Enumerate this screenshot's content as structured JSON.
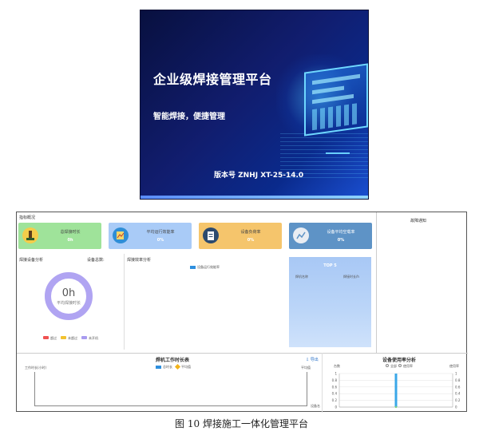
{
  "splash": {
    "title": "企业级焊接管理平台",
    "subtitle": "智能焊接，便捷管理",
    "version": "版本号 ZNHJ XT-25-14.0"
  },
  "overview": {
    "title": "指标概况",
    "kpis": [
      {
        "label": "总焊接时长",
        "value": "0h",
        "icon": "welder-icon",
        "color": "#9fe39a"
      },
      {
        "label": "平均运行效能率",
        "value": "0%",
        "icon": "chart-icon",
        "color": "#a9cbf7"
      },
      {
        "label": "设备负荷率",
        "value": "0%",
        "icon": "clipboard-icon",
        "color": "#f5c56c"
      },
      {
        "label": "设备平均空载率",
        "value": "0%",
        "icon": "gauge-icon",
        "color": "#5e93c6"
      }
    ]
  },
  "notice": {
    "title": "故障通知"
  },
  "device_analysis": {
    "title": "焊接设备分析",
    "total_label": "设备总数:",
    "donut_value": "0h",
    "donut_label": "平均焊接时长",
    "legend": [
      {
        "label": "超过",
        "color": "#f05252"
      },
      {
        "label": "未超过",
        "color": "#f2c230"
      },
      {
        "label": "未开机",
        "color": "#a99cf0"
      }
    ]
  },
  "efficiency": {
    "title": "焊接效率分析",
    "legend": "设备运行效能率"
  },
  "top5": {
    "title": "TOP 5",
    "col1": "焊机名称",
    "col2": "焊接时长/h"
  },
  "work_time": {
    "title": "焊机工作时长表",
    "export": "⇩ 导出",
    "legend1": "总时长",
    "legend2": "平均值",
    "y_left": "工作时长(小时)",
    "y_right": "平均值",
    "x_right": "设备名"
  },
  "utilization": {
    "title": "设备使用率分析",
    "legend1": "全部",
    "legend2": "使用率",
    "y_left": "台数",
    "y_right": "使用率",
    "chart_data": {
      "type": "bar",
      "yticks_left": [
        "0",
        "0.2",
        "0.4",
        "0.6",
        "0.8",
        "1"
      ],
      "yticks_right": [
        "0",
        "0.2",
        "0.4",
        "0.6",
        "0.8",
        "1"
      ],
      "ylim": [
        0,
        1
      ],
      "categories": [
        ""
      ],
      "values": [
        1
      ],
      "bar_color": "#3aa7e8",
      "grid": true
    }
  },
  "caption": "图 10  焊接施工一体化管理平台"
}
